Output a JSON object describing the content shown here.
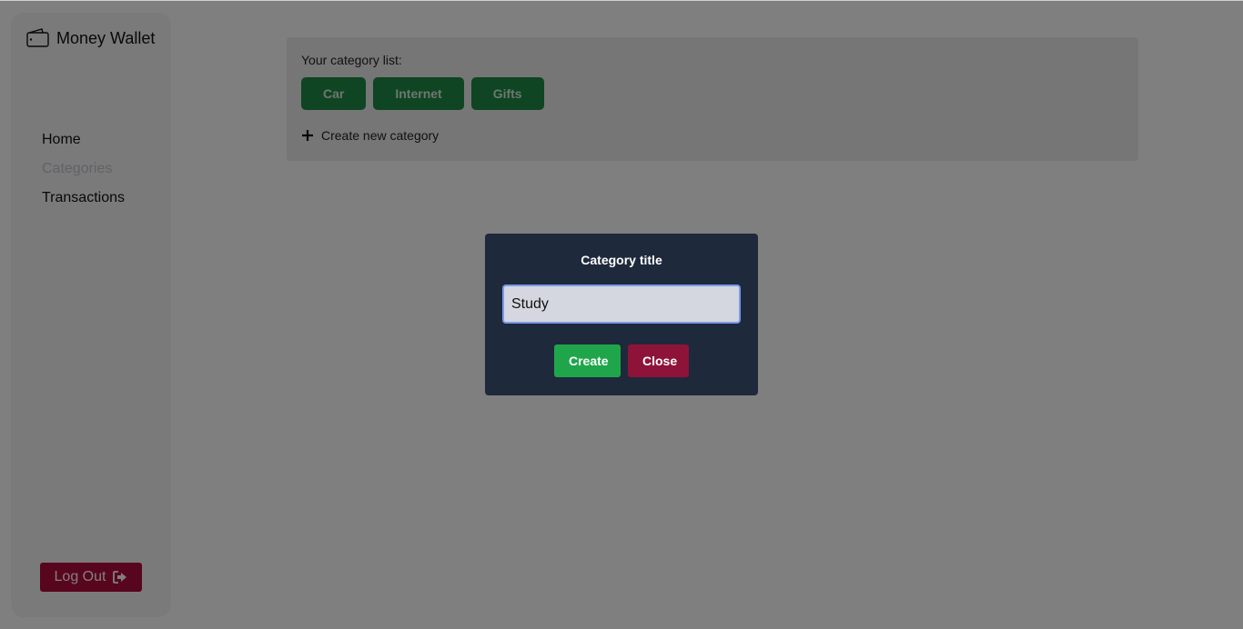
{
  "sidebar": {
    "brand_title": "Money Wallet",
    "brand_icon": "wallet-icon",
    "nav": [
      {
        "label": "Home",
        "active": false
      },
      {
        "label": "Categories",
        "active": true
      },
      {
        "label": "Transactions",
        "active": false
      }
    ],
    "logout_label": "Log Out",
    "logout_icon": "sign-out-icon"
  },
  "categories": {
    "list_label": "Your category list:",
    "items": [
      "Car",
      "Internet",
      "Gifts"
    ],
    "create_new_label": "Create new category"
  },
  "modal": {
    "title": "Category title",
    "input_value": "Study",
    "create_label": "Create",
    "close_label": "Close"
  },
  "colors": {
    "chip": "#1e8a45",
    "modal_bg": "#1e293b",
    "create": "#1fa64a",
    "close": "#8e1338",
    "logout": "#b00d3a"
  }
}
